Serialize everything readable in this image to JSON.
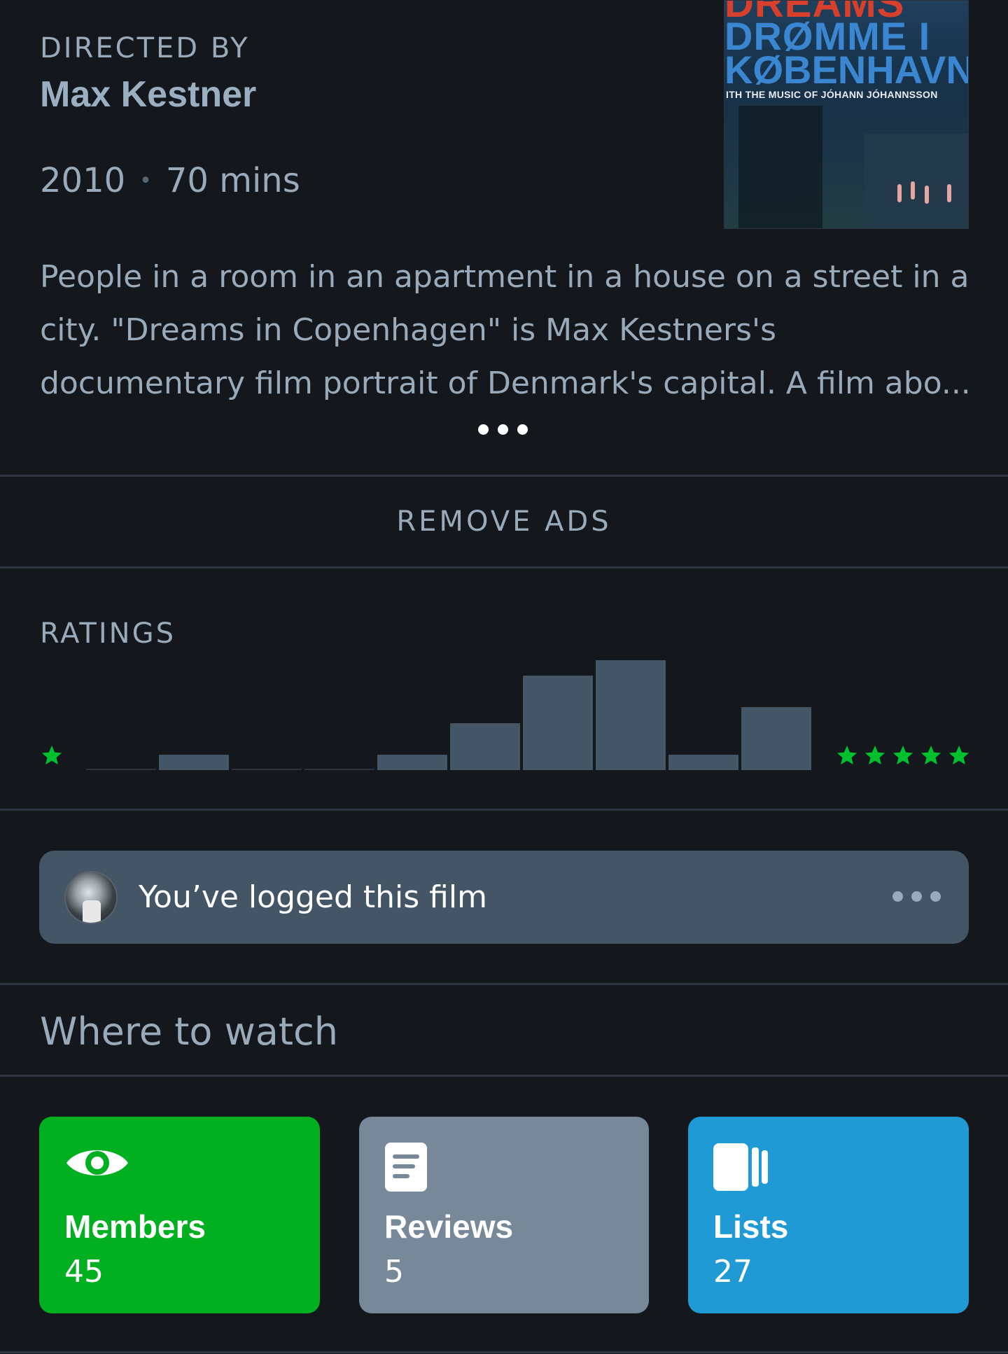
{
  "film": {
    "directed_by_label": "DIRECTED BY",
    "director": "Max Kestner",
    "year": "2010",
    "separator": "•",
    "runtime": "70 mins",
    "synopsis": "People in a room in an apartment in a house on a street in a city. \"Dreams in Copenhagen\" is Max Kestners's documentary film portrait of Denmark's capital. A film abo..."
  },
  "poster": {
    "title_top": "DREAMS",
    "title_line1": "DRØMME I",
    "title_line2": "KØBENHAVN",
    "credit": "ITH THE MUSIC OF JÓHANN JÓHANNSSON"
  },
  "ads": {
    "remove_label": "REMOVE ADS"
  },
  "ratings": {
    "label": "RATINGS"
  },
  "chart_data": {
    "type": "bar",
    "categories": [
      "0.5",
      "1",
      "1.5",
      "2",
      "2.5",
      "3",
      "3.5",
      "4",
      "4.5",
      "5"
    ],
    "values": [
      0,
      1,
      0,
      0,
      1,
      3,
      6,
      7,
      1,
      4
    ],
    "bar_color": "#445566",
    "star_color": "#00c030"
  },
  "logged": {
    "text": "You’ve logged this film"
  },
  "where_to_watch": {
    "title": "Where to watch"
  },
  "stats": {
    "members": {
      "label": "Members",
      "value": "45",
      "icon": "eye-icon",
      "color": "#00b020"
    },
    "reviews": {
      "label": "Reviews",
      "value": "5",
      "icon": "document-icon",
      "color": "#778899"
    },
    "lists": {
      "label": "Lists",
      "value": "27",
      "icon": "stacked-cards-icon",
      "color": "#209ad5"
    }
  }
}
